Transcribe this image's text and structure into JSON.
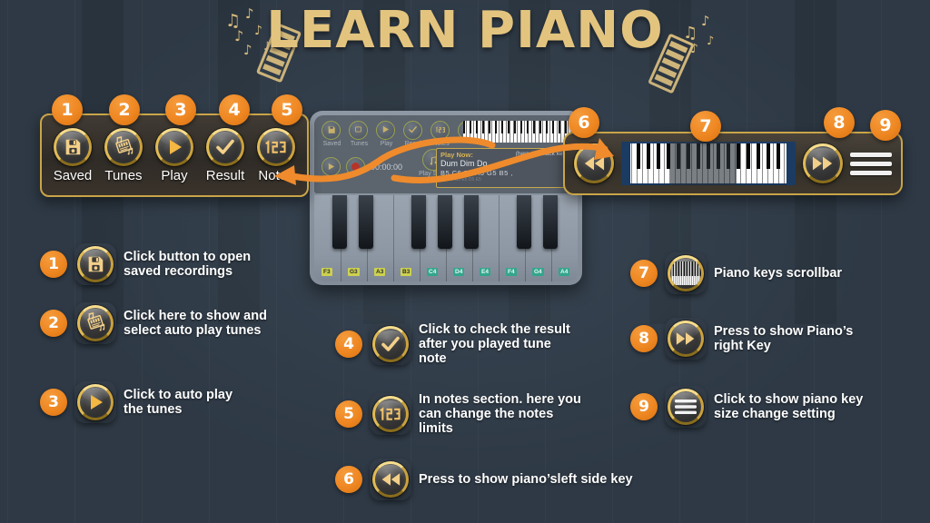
{
  "header": {
    "title": "LEARN PIANO",
    "title_color": "#e3c47f",
    "decor_left": "music-notes-keyboard",
    "decor_right": "music-notes-keyboard"
  },
  "theme": {
    "background": "#2e3945",
    "accent_orange": "#ee8722",
    "accent_gold": "#f0c040",
    "panel_border": "#c9a548"
  },
  "toolbar_panel": {
    "items": [
      {
        "num": "1",
        "label": "Saved",
        "icon": "save-icon"
      },
      {
        "num": "2",
        "label": "Tunes",
        "icon": "music-sheet-icon"
      },
      {
        "num": "3",
        "label": "Play",
        "icon": "play-icon"
      },
      {
        "num": "4",
        "label": "Result",
        "icon": "check-icon"
      },
      {
        "num": "5",
        "label": "Notes",
        "icon": "digits-123-icon"
      }
    ]
  },
  "scroll_panel": {
    "items": [
      {
        "num": "6",
        "icon": "rewind-icon"
      },
      {
        "num": "7",
        "icon": "piano-scrollbar-icon"
      },
      {
        "num": "8",
        "icon": "fast-forward-icon"
      },
      {
        "num": "9",
        "icon": "hamburger-menu-icon"
      }
    ]
  },
  "app": {
    "tools": [
      {
        "label": "Saved",
        "icon": "save-icon"
      },
      {
        "label": "Tunes",
        "icon": "music-sheet-icon"
      },
      {
        "label": "Play",
        "icon": "play-icon"
      },
      {
        "label": "Result",
        "icon": "check-icon"
      },
      {
        "label": "Notes",
        "icon": "digits-123-icon"
      },
      {
        "label": "",
        "icon": "rewind-icon"
      }
    ],
    "timer": "00:00:00",
    "play_song_notes_label": "Play Song\nNotes",
    "play_now": {
      "title": "Play Now:",
      "hint": "(here # = black key)",
      "song": "Dum Dim Do",
      "notes": "B5  C6  B5  A5  G5  B5 ,",
      "faint": "G5 F5 G5 E5 D5 E5"
    },
    "key_labels": [
      {
        "text": "F3",
        "tone": "y"
      },
      {
        "text": "G3",
        "tone": "y"
      },
      {
        "text": "A3",
        "tone": "y"
      },
      {
        "text": "B3",
        "tone": "y"
      },
      {
        "text": "C4",
        "tone": "t"
      },
      {
        "text": "D4",
        "tone": "t"
      },
      {
        "text": "E4",
        "tone": "t"
      },
      {
        "text": "F4",
        "tone": "t"
      },
      {
        "text": "G4",
        "tone": "t"
      },
      {
        "text": "A4",
        "tone": "t"
      }
    ]
  },
  "legend": {
    "items": [
      {
        "num": "1",
        "icon": "save-icon",
        "text": "Click button to open\nsaved recordings"
      },
      {
        "num": "2",
        "icon": "music-sheet-icon",
        "text": "Click here to show and\nselect  auto play tunes"
      },
      {
        "num": "3",
        "icon": "play-icon",
        "text": "Click to auto play\nthe tunes"
      },
      {
        "num": "4",
        "icon": "check-icon",
        "text": "Click to check the result\nafter you played tune\nnote"
      },
      {
        "num": "5",
        "icon": "digits-123-icon",
        "text": "In notes section. here you\n can change the notes\nlimits"
      },
      {
        "num": "6",
        "icon": "rewind-icon",
        "text": "Press to show piano’sleft side key"
      },
      {
        "num": "7",
        "icon": "piano-scrollbar-icon",
        "text": "Piano keys scrollbar"
      },
      {
        "num": "8",
        "icon": "fast-forward-icon",
        "text": "Press to show Piano’s\nright Key"
      },
      {
        "num": "9",
        "icon": "hamburger-menu-icon",
        "text": "Click to show  piano key\nsize change setting"
      }
    ]
  }
}
